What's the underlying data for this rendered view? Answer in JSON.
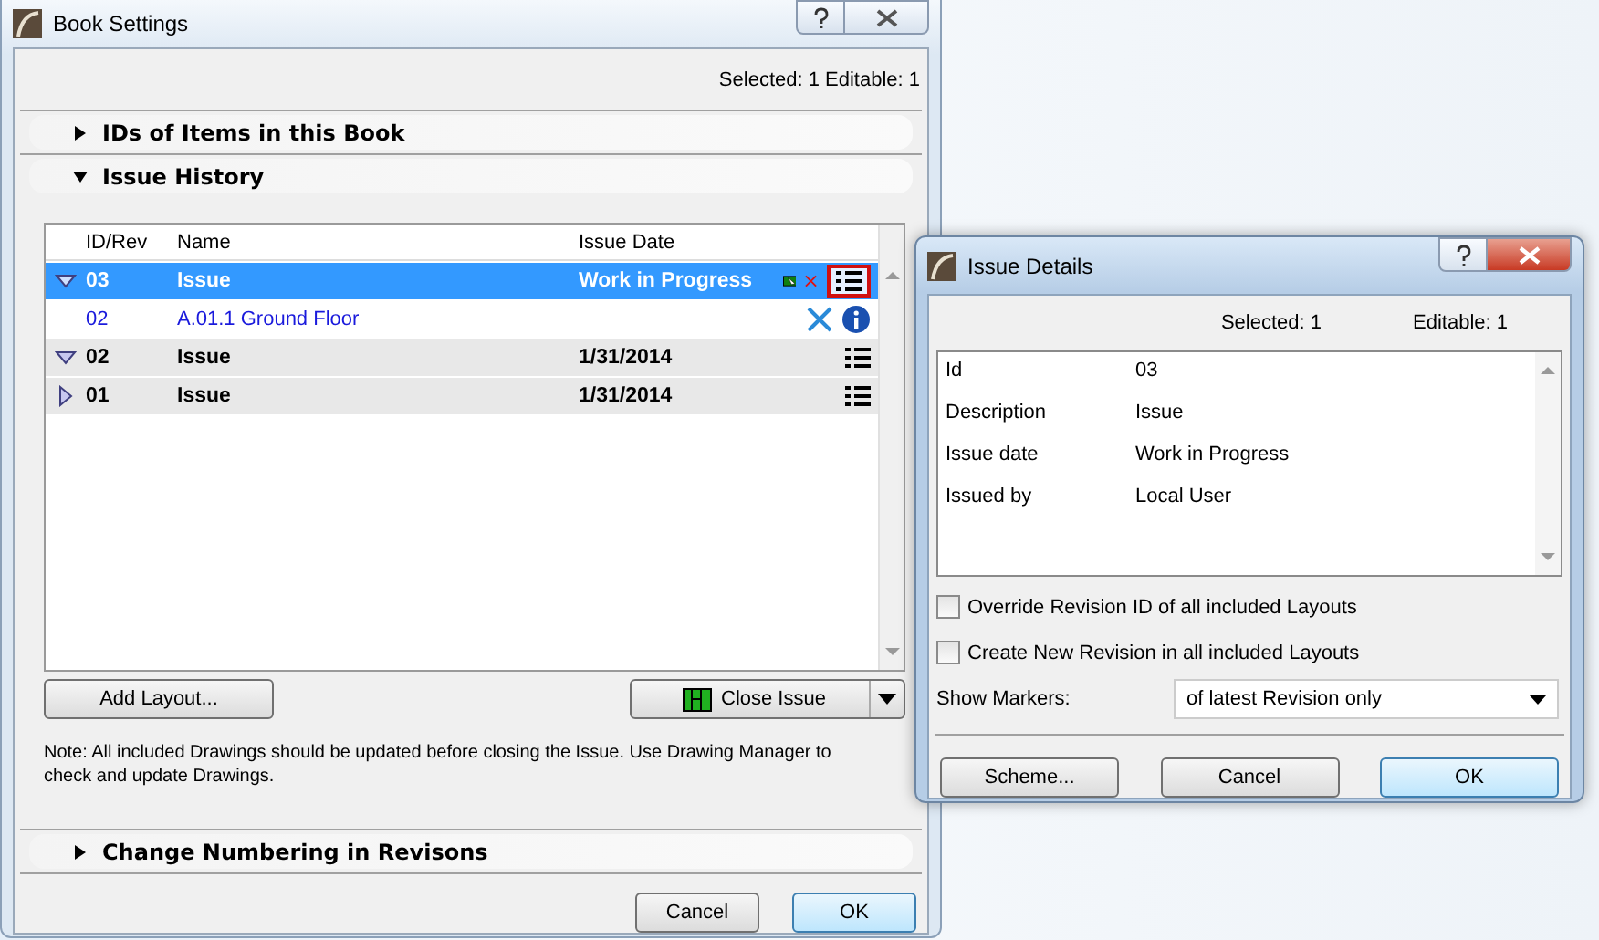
{
  "book_settings": {
    "title": "Book Settings",
    "summary": "Selected: 1 Editable: 1",
    "sections_top": [
      {
        "label": "IDs of Items in this Book",
        "expanded": false
      },
      {
        "label": "Issue History",
        "expanded": true
      }
    ],
    "table": {
      "columns": [
        "ID/Rev",
        "Name",
        "Issue Date"
      ],
      "rows": [
        {
          "kind": "issue",
          "id": "03",
          "name": "Issue",
          "date": "Work in Progress",
          "expanded": true,
          "selected": true
        },
        {
          "kind": "layout",
          "id": "02",
          "name": "A.01.1 Ground Floor",
          "date": "",
          "selected": false
        },
        {
          "kind": "issue",
          "id": "02",
          "name": "Issue",
          "date": "1/31/2014",
          "expanded": true,
          "selected": false
        },
        {
          "kind": "issue",
          "id": "01",
          "name": "Issue",
          "date": "1/31/2014",
          "expanded": false,
          "selected": false
        }
      ]
    },
    "add_button": "Add Layout...",
    "close_button": "Close Issue",
    "note": "Note: All included Drawings should be updated before closing the Issue. Use Drawing Manager to check and update Drawings.",
    "section_bottom": {
      "label": "Change Numbering in Revisons",
      "expanded": false
    },
    "buttons": [
      "Cancel",
      "OK"
    ]
  },
  "issue_details": {
    "title": "Issue Details",
    "selected": "Selected:  1",
    "editable": "Editable:  1",
    "properties": [
      {
        "label": "Id",
        "value": "03"
      },
      {
        "label": "Description",
        "value": "Issue"
      },
      {
        "label": "Issue date",
        "value": "Work in Progress"
      },
      {
        "label": "Issued by",
        "value": "Local User"
      }
    ],
    "options": [
      {
        "label": "Override Revision ID of all included Layouts",
        "checked": false
      },
      {
        "label": "Create New Revision in all included Layouts",
        "checked": false
      }
    ],
    "show_markers": {
      "label": "Show Markers:",
      "value": "of latest Revision only"
    },
    "buttons": [
      "Scheme...",
      "Cancel",
      "OK"
    ]
  }
}
